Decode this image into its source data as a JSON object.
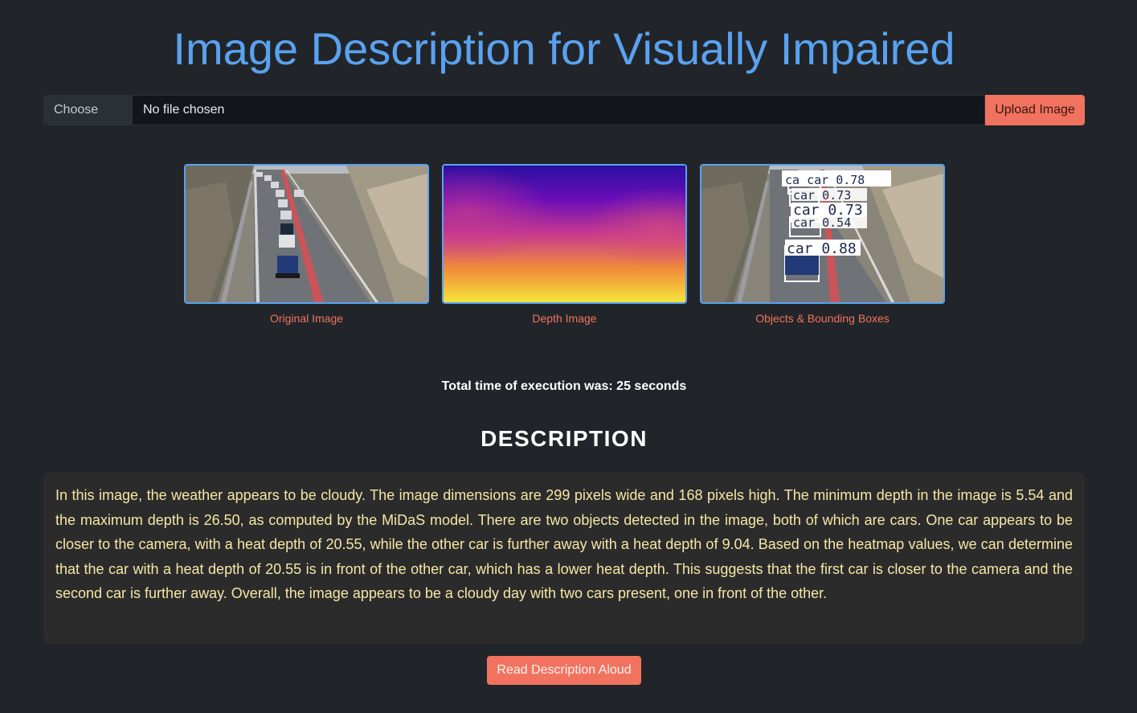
{
  "header": {
    "title": "Image Description for Visually Impaired"
  },
  "upload": {
    "choose_label": "Choose File",
    "file_status": "No file chosen",
    "upload_label": "Upload Image"
  },
  "colors": {
    "accent_blue": "#5aa2f0",
    "accent_coral": "#f1735f",
    "description_text": "#f5e7a6",
    "background": "#212529"
  },
  "gallery": [
    {
      "caption": "Original Image"
    },
    {
      "caption": "Depth Image"
    },
    {
      "caption": "Objects & Bounding Boxes",
      "detections": [
        "car 0.78",
        "car 0.73",
        "car 0.73",
        "car 0.54",
        "car 0.88"
      ]
    }
  ],
  "execution": {
    "text": "Total time of execution was: 25 seconds"
  },
  "description": {
    "heading": "DESCRIPTION",
    "text": "In this image, the weather appears to be cloudy. The image dimensions are 299 pixels wide and 168 pixels high. The minimum depth in the image is 5.54 and the maximum depth is 26.50, as computed by the MiDaS model. There are two objects detected in the image, both of which are cars. One car appears to be closer to the camera, with a heat depth of 20.55, while the other car is further away with a heat depth of 9.04. Based on the heatmap values, we can determine that the car with a heat depth of 20.55 is in front of the other car, which has a lower heat depth. This suggests that the first car is closer to the camera and the second car is further away. Overall, the image appears to be a cloudy day with two cars present, one in front of the other."
  },
  "actions": {
    "read_aloud_label": "Read Description Aloud"
  }
}
